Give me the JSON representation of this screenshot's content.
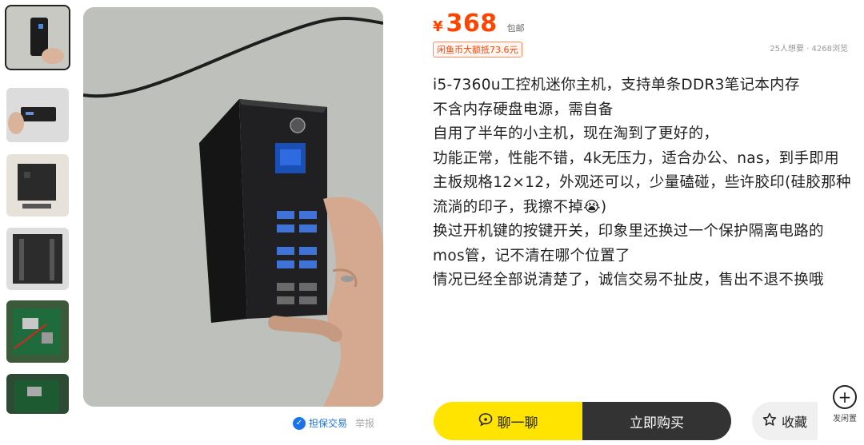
{
  "price": {
    "currency": "¥",
    "amount": "368",
    "shipping": "包邮"
  },
  "coin_badge": "闲鱼币大额抵73.6元",
  "stats": "25人想要 · 4268浏览",
  "description": [
    "i5-7360u工控机迷你主机，支持单条DDR3笔记本内存",
    "不含内存硬盘电源，需自备",
    "自用了半年的小主机，现在淘到了更好的，",
    "功能正常，性能不错，4k无压力，适合办公、nas，到手即用",
    "主板规格12×12，外观还可以，少量磕碰，些许胶印(硅胶那种流淌的印子，我擦不掉😭)",
    "换过开机键的按键开关，印象里还换过一个保护隔离电路的mos管，记不清在哪个位置了",
    "情况已经全部说清楚了，诚信交易不扯皮，售出不退不换哦"
  ],
  "guarantee": {
    "label": "担保交易",
    "report": "举报"
  },
  "actions": {
    "chat": "聊一聊",
    "buy": "立即购买",
    "favorite": "收藏",
    "publish": "发闲置"
  },
  "icons": {
    "chat": "chat-bubble-icon",
    "favorite": "star-icon",
    "publish": "plus-circle-icon",
    "guarantee": "shield-icon"
  },
  "colors": {
    "price": "#ff4400",
    "chat_button": "#ffe400",
    "buy_button": "#333333",
    "guarantee": "#1a73e8"
  }
}
